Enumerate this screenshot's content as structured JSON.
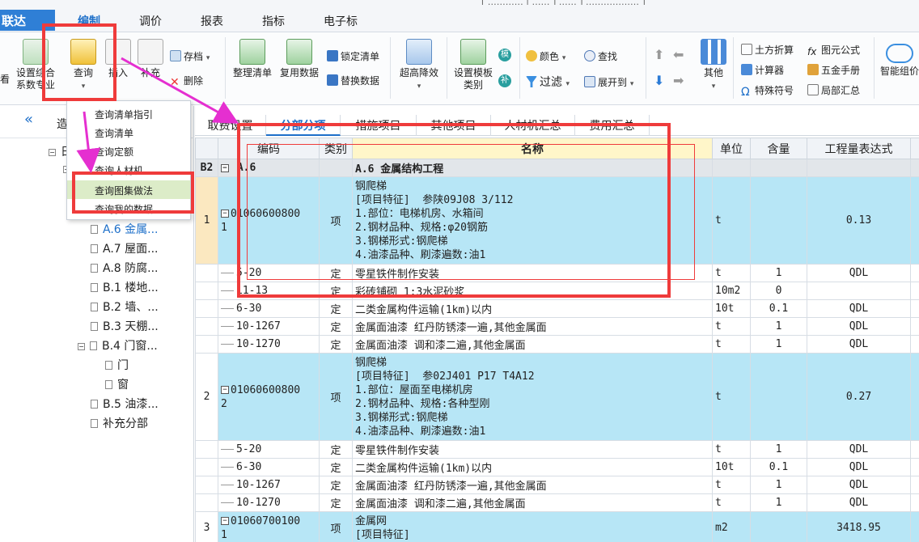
{
  "app": {
    "brand": "联达",
    "topstrip": "[ ………… | …… ] …… ] ……………… ]"
  },
  "menu": {
    "items": [
      "编制",
      "调价",
      "报表",
      "指标",
      "电子标"
    ]
  },
  "ribbon": {
    "kan": "看",
    "shezhi_zonghe": "设置综合",
    "xishu": "系数专业",
    "chaxun": "查询",
    "charu": "插入",
    "buchong": "补充",
    "cundang": "存档",
    "shanchu": "删除",
    "zhengli": "整理清单",
    "fuyong": "复用数据",
    "suoding": "锁定清单",
    "tihuan": "替换数据",
    "chaogao": "超高降效",
    "moban": "设置模板",
    "leibie": "类别",
    "mo": "模",
    "fu": "补",
    "yanse": "颜色",
    "chazhao": "查找",
    "guolv": "过滤",
    "zhankai": "展开到",
    "qita": "其他",
    "tufang": "土方折算",
    "jisuanqi": "计算器",
    "teshu": "特殊符号",
    "tuyuan": "图元公式",
    "wujin": "五金手册",
    "jubu": "局部汇总",
    "zhineng": "智能组价"
  },
  "dropdown": {
    "items": [
      "查询清单指引",
      "查询清单",
      "查询定额",
      "查询人材机",
      "查询图集做法",
      "查询我的数据"
    ]
  },
  "tabs": [
    "取费设置",
    "分部分项",
    "措施项目",
    "其他项目",
    "人材机汇总",
    "费用汇总"
  ],
  "left": {
    "head": "造",
    "tree": [
      "A.6 金属...",
      "A.7 屋面...",
      "A.8 防腐...",
      "B.1 楼地...",
      "B.2 墙、...",
      "B.3 天棚...",
      "B.4 门窗...",
      "门",
      "窗",
      "B.5 油漆...",
      "补充分部"
    ]
  },
  "grid": {
    "headers": [
      "编码",
      "类别",
      "名称",
      "单位",
      "含量",
      "工程量表达式"
    ],
    "section": {
      "rowno": "B2",
      "code": "A.6",
      "name": "A.6  金属结构工程"
    },
    "rows": [
      {
        "rowno": "1",
        "code": "01060600800\n1",
        "type": "项",
        "name": "钢爬梯\n[项目特征]  参陕09J08 3/112\n1.部位：电梯机房、水箱间\n2.钢材品种、规格:φ20钢筋\n3.钢梯形式:钢爬梯\n4.油漆品种、刷漆遍数:油1",
        "unit": "t",
        "qty": "",
        "expr": "0.13"
      },
      {
        "sub": true,
        "code": "5-20",
        "type": "定",
        "name": "零星铁件制作安装",
        "unit": "t",
        "qty": "1",
        "expr": "QDL"
      },
      {
        "sub": true,
        "code": "11-13",
        "type": "定",
        "name": "彩砖铺砌 1:3水泥砂浆",
        "unit": "10m2",
        "qty": "0",
        "expr": ""
      },
      {
        "sub": true,
        "code": "6-30",
        "type": "定",
        "name": "二类金属构件运输(1km)以内",
        "unit": "10t",
        "qty": "0.1",
        "expr": "QDL"
      },
      {
        "sub": true,
        "code": "10-1267",
        "type": "定",
        "name": "金属面油漆 红丹防锈漆一遍,其他金属面",
        "unit": "t",
        "qty": "1",
        "expr": "QDL"
      },
      {
        "sub": true,
        "code": "10-1270",
        "type": "定",
        "name": "金属面油漆 调和漆二遍,其他金属面",
        "unit": "t",
        "qty": "1",
        "expr": "QDL"
      },
      {
        "rowno": "2",
        "code": "01060600800\n2",
        "type": "项",
        "name": "钢爬梯\n[项目特征]  参02J401 P17 T4A12\n1.部位：屋面至电梯机房\n2.钢材品种、规格:各种型刚\n3.钢梯形式:钢爬梯\n4.油漆品种、刷漆遍数:油1",
        "unit": "t",
        "qty": "",
        "expr": "0.27"
      },
      {
        "sub": true,
        "code": "5-20",
        "type": "定",
        "name": "零星铁件制作安装",
        "unit": "t",
        "qty": "1",
        "expr": "QDL"
      },
      {
        "sub": true,
        "code": "6-30",
        "type": "定",
        "name": "二类金属构件运输(1km)以内",
        "unit": "10t",
        "qty": "0.1",
        "expr": "QDL"
      },
      {
        "sub": true,
        "code": "10-1267",
        "type": "定",
        "name": "金属面油漆 红丹防锈漆一遍,其他金属面",
        "unit": "t",
        "qty": "1",
        "expr": "QDL"
      },
      {
        "sub": true,
        "code": "10-1270",
        "type": "定",
        "name": "金属面油漆 调和漆二遍,其他金属面",
        "unit": "t",
        "qty": "1",
        "expr": "QDL"
      },
      {
        "rowno": "3",
        "code": "01060700100\n1",
        "type": "项",
        "name": "金属网\n[项目特征]",
        "unit": "m2",
        "qty": "",
        "expr": "3418.95"
      }
    ]
  },
  "colors": {
    "accent": "#1d6fc9",
    "highlight_row": "#b7e6f6",
    "annotation": "#ef3b3b"
  }
}
